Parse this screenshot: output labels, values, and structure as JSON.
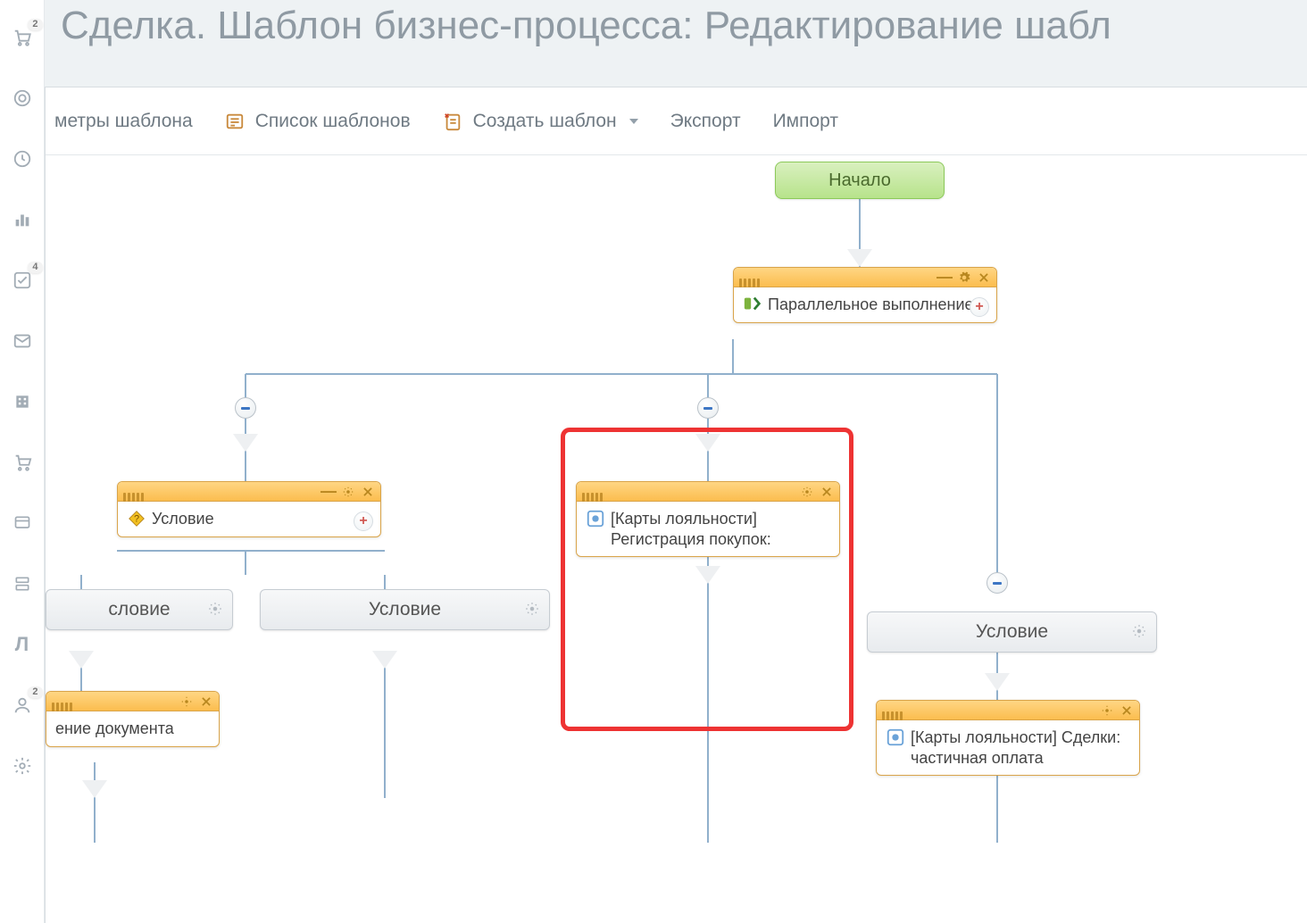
{
  "rail": {
    "items": [
      {
        "name": "cart-icon",
        "badge": "2"
      },
      {
        "name": "target-icon",
        "badge": null
      },
      {
        "name": "clock-icon",
        "badge": null
      },
      {
        "name": "chart-icon",
        "badge": null
      },
      {
        "name": "check-icon",
        "badge": "4"
      },
      {
        "name": "mail-icon",
        "badge": null
      },
      {
        "name": "building-icon",
        "badge": null
      },
      {
        "name": "shop-icon",
        "badge": null
      },
      {
        "name": "window-icon",
        "badge": null
      },
      {
        "name": "servers-icon",
        "badge": null
      },
      {
        "name": "logo-icon",
        "badge": null
      },
      {
        "name": "admin-icon",
        "badge": "2"
      },
      {
        "name": "settings-icon",
        "badge": null
      }
    ]
  },
  "page_title": "Сделка. Шаблон бизнес-процесса: Редактирование шабл",
  "toolbar": {
    "params": "метры шаблона",
    "list": "Список шаблонов",
    "create": "Создать шаблон",
    "export": "Экспорт",
    "import": "Импорт"
  },
  "nodes": {
    "start": "Начало",
    "parallel": "Параллельное выполнение",
    "condition": "Условие",
    "loyalty_reg": "[Карты лояльности] Регистрация покупок:",
    "doc": "ение документа",
    "loyalty_partial": "[Карты лояльности] Сделки: частичная оплата"
  },
  "cond_labels": {
    "c1": "словие",
    "c2": "Условие",
    "c3": "Условие"
  }
}
